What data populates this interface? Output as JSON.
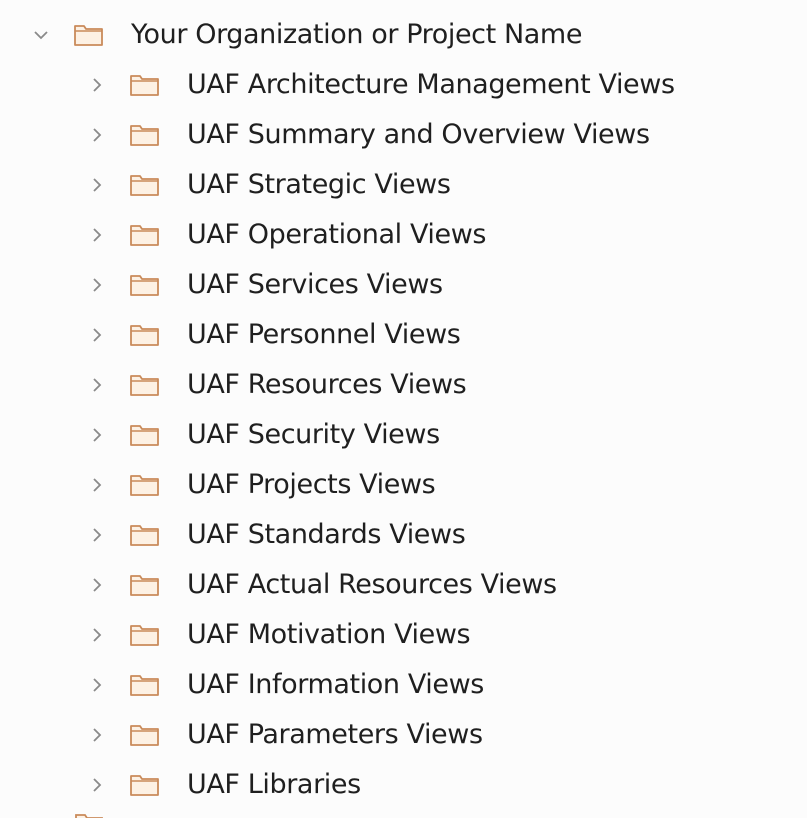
{
  "colors": {
    "folder_stroke": "#c98a5a",
    "folder_fill": "#fdf1e4",
    "chevron": "#8a8a8a",
    "text": "#1f1f1f"
  },
  "root": {
    "label": "Your Organization or Project Name",
    "expanded": true
  },
  "children": [
    {
      "label": "UAF Architecture Management Views"
    },
    {
      "label": "UAF Summary and Overview Views"
    },
    {
      "label": "UAF Strategic Views"
    },
    {
      "label": "UAF Operational Views"
    },
    {
      "label": "UAF Services Views"
    },
    {
      "label": "UAF Personnel Views"
    },
    {
      "label": "UAF Resources Views"
    },
    {
      "label": "UAF Security Views"
    },
    {
      "label": "UAF Projects Views"
    },
    {
      "label": "UAF Standards Views"
    },
    {
      "label": "UAF Actual Resources Views"
    },
    {
      "label": "UAF Motivation Views"
    },
    {
      "label": "UAF Information Views"
    },
    {
      "label": "UAF Parameters Views"
    },
    {
      "label": "UAF Libraries"
    }
  ]
}
